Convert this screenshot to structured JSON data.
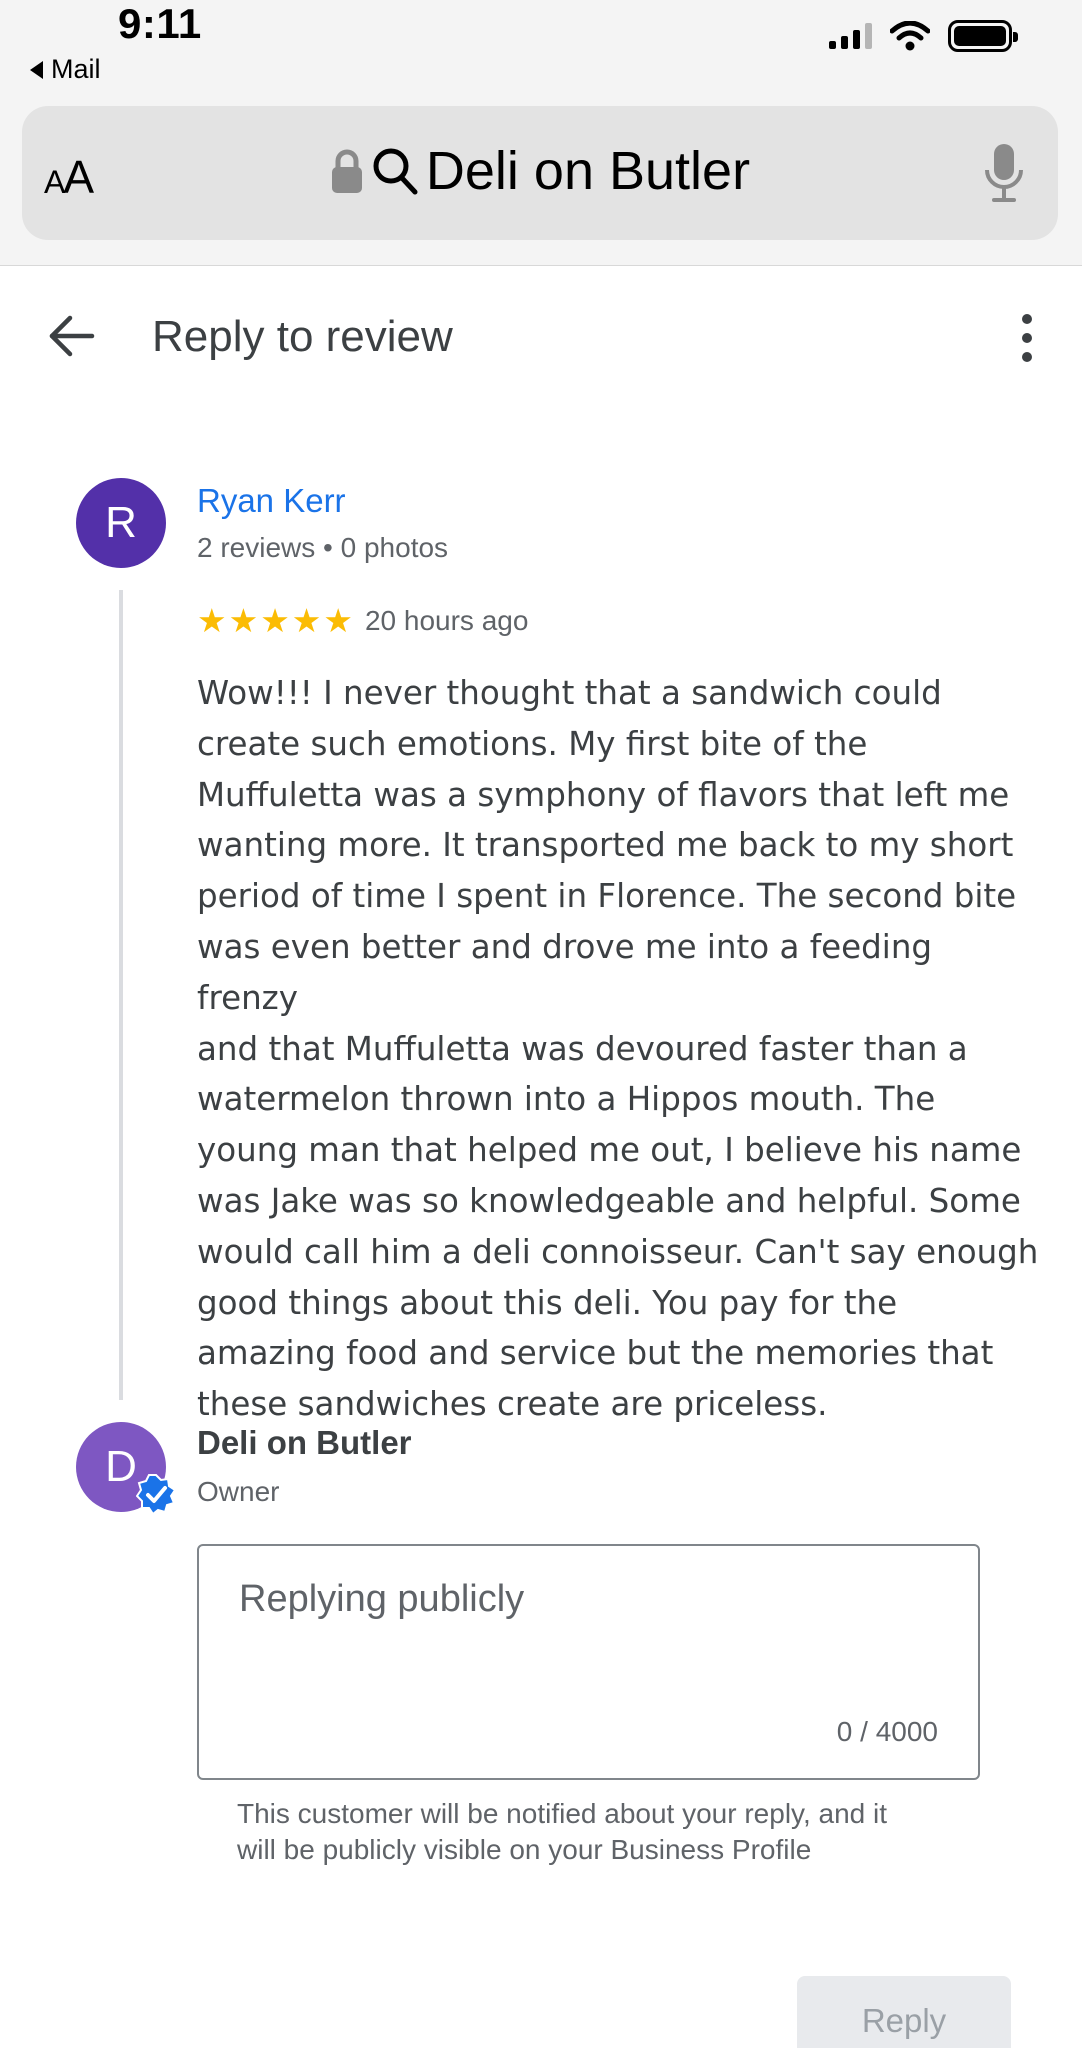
{
  "status_bar": {
    "time": "9:11",
    "back_app": "Mail"
  },
  "browser": {
    "aa_small": "A",
    "aa_large": "A",
    "url_text": "Deli on Butler",
    "icons": [
      "lock-icon",
      "search-icon",
      "microphone-icon"
    ]
  },
  "header": {
    "title": "Reply to review",
    "icons": [
      "back-arrow-icon",
      "more-vert-icon"
    ]
  },
  "review": {
    "avatar_letter": "R",
    "avatar_color": "#5330a9",
    "reviewer_name": "Ryan Kerr",
    "reviewer_meta": "2 reviews • 0 photos",
    "rating": 5,
    "rating_max": 5,
    "time_ago": "20 hours ago",
    "lines": [
      "Wow!!! I never thought that a sandwich could",
      "create such emotions. My first bite of the",
      "Muffuletta was a symphony of flavors that left me",
      "wanting more. It transported me back to my short",
      "period of time I spent in Florence. The second bite",
      "was even better and drove me into a feeding frenzy",
      "and that Muffuletta was devoured faster than a",
      "watermelon thrown into a Hippos mouth. The",
      "young man that helped me out, I believe his name",
      "was Jake was so knowledgeable and helpful. Some",
      "would call him a deli connoisseur. Can't say enough",
      "good things about this deli. You pay for the",
      "amazing food and service but the memories that",
      "these sandwiches create are priceless."
    ]
  },
  "owner": {
    "avatar_letter": "D",
    "avatar_color": "#7e57c2",
    "name": "Deli on Butler",
    "role": "Owner",
    "verified_color": "#1a73e8"
  },
  "reply": {
    "placeholder": "Replying publicly",
    "counter": "0 / 4000",
    "help_line1": "This customer will be notified about your reply, and it",
    "help_line2": "will be publicly visible on your Business Profile",
    "button_label": "Reply"
  },
  "colors": {
    "link_blue": "#1a73e8",
    "star_yellow": "#fbbc04",
    "text_gray": "#5f6368"
  }
}
